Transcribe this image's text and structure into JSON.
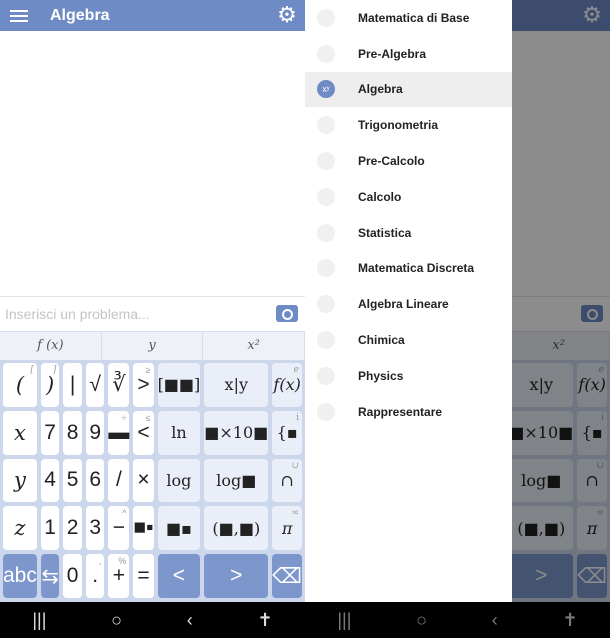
{
  "app": {
    "title": "Algebra",
    "input_placeholder": "Inserisci un problema...",
    "tabs": [
      "f (x)",
      "y",
      "x²"
    ]
  },
  "colors": {
    "accent": "#6f8bc6",
    "keyboard_bg": "#cdd7eb",
    "dark_key": "#7d97cd"
  },
  "keyboard": [
    [
      {
        "l": "(",
        "s": "[",
        "c": "it"
      },
      {
        "l": ")",
        "s": "]",
        "c": "it"
      },
      {
        "l": "|"
      },
      {
        "l": "√"
      },
      {
        "l": "∛"
      },
      {
        "l": ">",
        "s": "≥"
      },
      {
        "l": "[■■]",
        "c": "lt"
      },
      {
        "l": "x|y",
        "c": "lt"
      },
      {
        "l": "f(x)",
        "s": "e",
        "c": "lt it"
      }
    ],
    [
      {
        "l": "x",
        "c": "it"
      },
      {
        "l": "7"
      },
      {
        "l": "8"
      },
      {
        "l": "9"
      },
      {
        "l": "▬",
        "s": "÷"
      },
      {
        "l": "<",
        "s": "≤"
      },
      {
        "l": "ln",
        "c": "lt"
      },
      {
        "l": "■×10■",
        "c": "lt"
      },
      {
        "l": "{▪",
        "s": "i",
        "c": "lt"
      }
    ],
    [
      {
        "l": "y",
        "c": "it"
      },
      {
        "l": "4"
      },
      {
        "l": "5"
      },
      {
        "l": "6"
      },
      {
        "l": "/"
      },
      {
        "l": "×"
      },
      {
        "l": "log",
        "c": "lt"
      },
      {
        "l": "log■",
        "c": "lt"
      },
      {
        "l": "∩",
        "s": "∪",
        "c": "lt"
      }
    ],
    [
      {
        "l": "z",
        "c": "it"
      },
      {
        "l": "1"
      },
      {
        "l": "2"
      },
      {
        "l": "3"
      },
      {
        "l": "−",
        "s": "^"
      },
      {
        "l": "■▪"
      },
      {
        "l": "■▪",
        "c": "lt"
      },
      {
        "l": "(■,■)",
        "c": "lt"
      },
      {
        "l": "π",
        "s": "∞",
        "c": "lt it"
      }
    ],
    [
      {
        "l": "abc",
        "c": "dk"
      },
      {
        "l": "⇆",
        "c": "dk"
      },
      {
        "l": "0"
      },
      {
        "l": ".",
        "s": ","
      },
      {
        "l": "+",
        "s": "%"
      },
      {
        "l": "="
      },
      {
        "l": "<",
        "c": "dk"
      },
      {
        "l": ">",
        "c": "dk"
      },
      {
        "l": "⌫",
        "c": "dk"
      }
    ]
  ],
  "drawer": {
    "selected": 2,
    "items": [
      {
        "label": "Matematica di Base",
        "icon": "plus"
      },
      {
        "label": "Pre-Algebra",
        "icon": "x"
      },
      {
        "label": "Algebra",
        "icon": "x^y"
      },
      {
        "label": "Trigonometria",
        "icon": "triangle"
      },
      {
        "label": "Pre-Calcolo",
        "icon": "graph"
      },
      {
        "label": "Calcolo",
        "icon": "integral"
      },
      {
        "label": "Statistica",
        "icon": "bar-chart"
      },
      {
        "label": "Matematica Discreta",
        "icon": "graph-nodes"
      },
      {
        "label": "Algebra Lineare",
        "icon": "matrix"
      },
      {
        "label": "Chimica",
        "icon": "flask"
      },
      {
        "label": "Physics",
        "icon": "atom"
      },
      {
        "label": "Rappresentare",
        "icon": "grid"
      }
    ]
  },
  "navbar": [
    "|||",
    "○",
    "‹",
    "✝"
  ]
}
